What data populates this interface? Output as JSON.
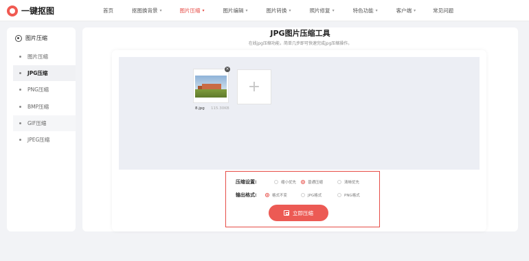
{
  "brand": {
    "name": "一键抠图"
  },
  "nav": [
    {
      "label": "首页",
      "has_caret": false,
      "active": false
    },
    {
      "label": "抠图换背景",
      "has_caret": true,
      "active": false
    },
    {
      "label": "图片压缩",
      "has_caret": true,
      "active": true
    },
    {
      "label": "图片编辑",
      "has_caret": true,
      "active": false
    },
    {
      "label": "图片转换",
      "has_caret": true,
      "active": false
    },
    {
      "label": "照片修复",
      "has_caret": true,
      "active": false
    },
    {
      "label": "特色功能",
      "has_caret": true,
      "active": false
    },
    {
      "label": "客户端",
      "has_caret": true,
      "active": false
    },
    {
      "label": "常见问题",
      "has_caret": false,
      "active": false
    }
  ],
  "sidebar": {
    "title": "图片压缩",
    "items": [
      {
        "label": "图片压缩",
        "active": false
      },
      {
        "label": "JPG压缩",
        "active": true
      },
      {
        "label": "PNG压缩",
        "active": false
      },
      {
        "label": "BMP压缩",
        "active": false
      },
      {
        "label": "GIF压缩",
        "active": false
      },
      {
        "label": "JPEG压缩",
        "active": false
      }
    ]
  },
  "main": {
    "title": "JPG图片压缩工具",
    "subtitle": "在线jpg压缩功能，简单几步即可快速完成jpg压缩操作。"
  },
  "upload": {
    "file_name": "8.jpg",
    "file_size": "115.30KB",
    "remove_symbol": "×",
    "add_symbol": "+"
  },
  "settings": {
    "compress_label": "压缩设置:",
    "compress_options": [
      {
        "label": "缩小优先",
        "selected": false
      },
      {
        "label": "普通压缩",
        "selected": true
      },
      {
        "label": "清晰优先",
        "selected": false
      }
    ],
    "format_label": "输出格式:",
    "format_options": [
      {
        "label": "格式不变",
        "selected": true
      },
      {
        "label": "JPG格式",
        "selected": false
      },
      {
        "label": "PNG格式",
        "selected": false
      }
    ],
    "button_label": "立即压缩"
  },
  "colors": {
    "accent": "#e64b45",
    "button": "#ec5a54",
    "page_bg": "#f2f3f6",
    "drop_bg": "#eceef4"
  }
}
